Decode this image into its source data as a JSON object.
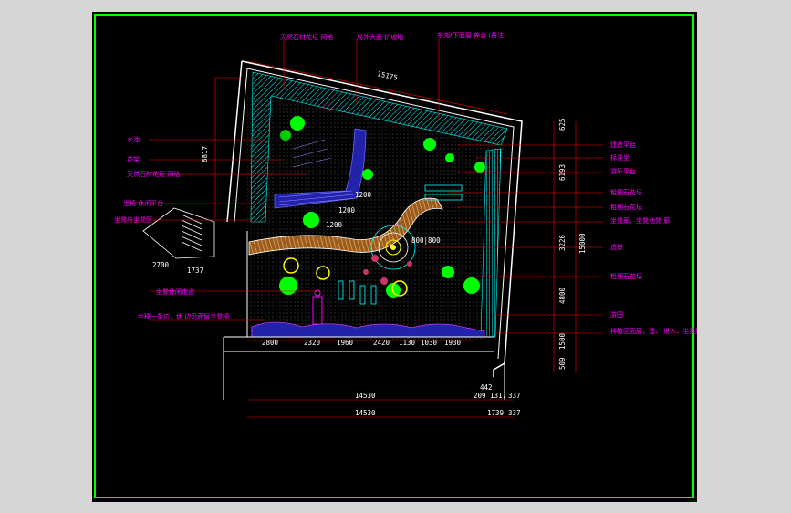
{
  "colors": {
    "background": "#000000",
    "frame": "#00ff00",
    "wall": "#ffffff",
    "label": "#ff00ff",
    "leader": "#ff0000",
    "hatch": "#00ffff",
    "plant": "#00ff00",
    "flower": "#ffff00",
    "path": "#ff6600",
    "water": "#3333ff",
    "dimension": "#ffffff"
  },
  "labels_top": [
    "天然石材花坛 网格",
    "局外大面 护坡墙",
    "东湖ℓ下面层 养台 (备注)"
  ],
  "labels_left": [
    "水池",
    "花架",
    "天然石材花坛 网格",
    "坐椅 休闲平台",
    "坐凳与坐凳区",
    "坐凳休闲走道",
    "坐椅一条边，休 边沿面层坐凳椅"
  ],
  "labels_right": [
    "建造平台",
    "标准坐",
    "游乐平台",
    "粗细石花坛",
    "粗细石花坛",
    "坐凳廊，坐凳池凳 廊",
    "造景",
    "粗细石花坛",
    "游园",
    "种植区面层，建、 进入，坐凳廊， 坐凳花坛"
  ],
  "dimensions": {
    "top_overall": "15175",
    "left_vertical": "8817",
    "stairs_a": "2700",
    "stairs_b": "1737",
    "inner_1": "1200",
    "inner_2": "1200",
    "inner_3": "1200",
    "inner_ring": "800|800",
    "bottom_segments": [
      "2800",
      "2320",
      "1960",
      "2420",
      "1130",
      "1030",
      "1930"
    ],
    "below_total_1": "14530",
    "below_total_2": "14530",
    "below_right_a": [
      "442",
      "209",
      "1317",
      "337"
    ],
    "below_right_b": [
      "1739",
      "337"
    ],
    "right_vertical": [
      "625",
      "6193",
      "3226",
      "4800",
      "1500",
      "509"
    ],
    "right_total": "15000"
  }
}
